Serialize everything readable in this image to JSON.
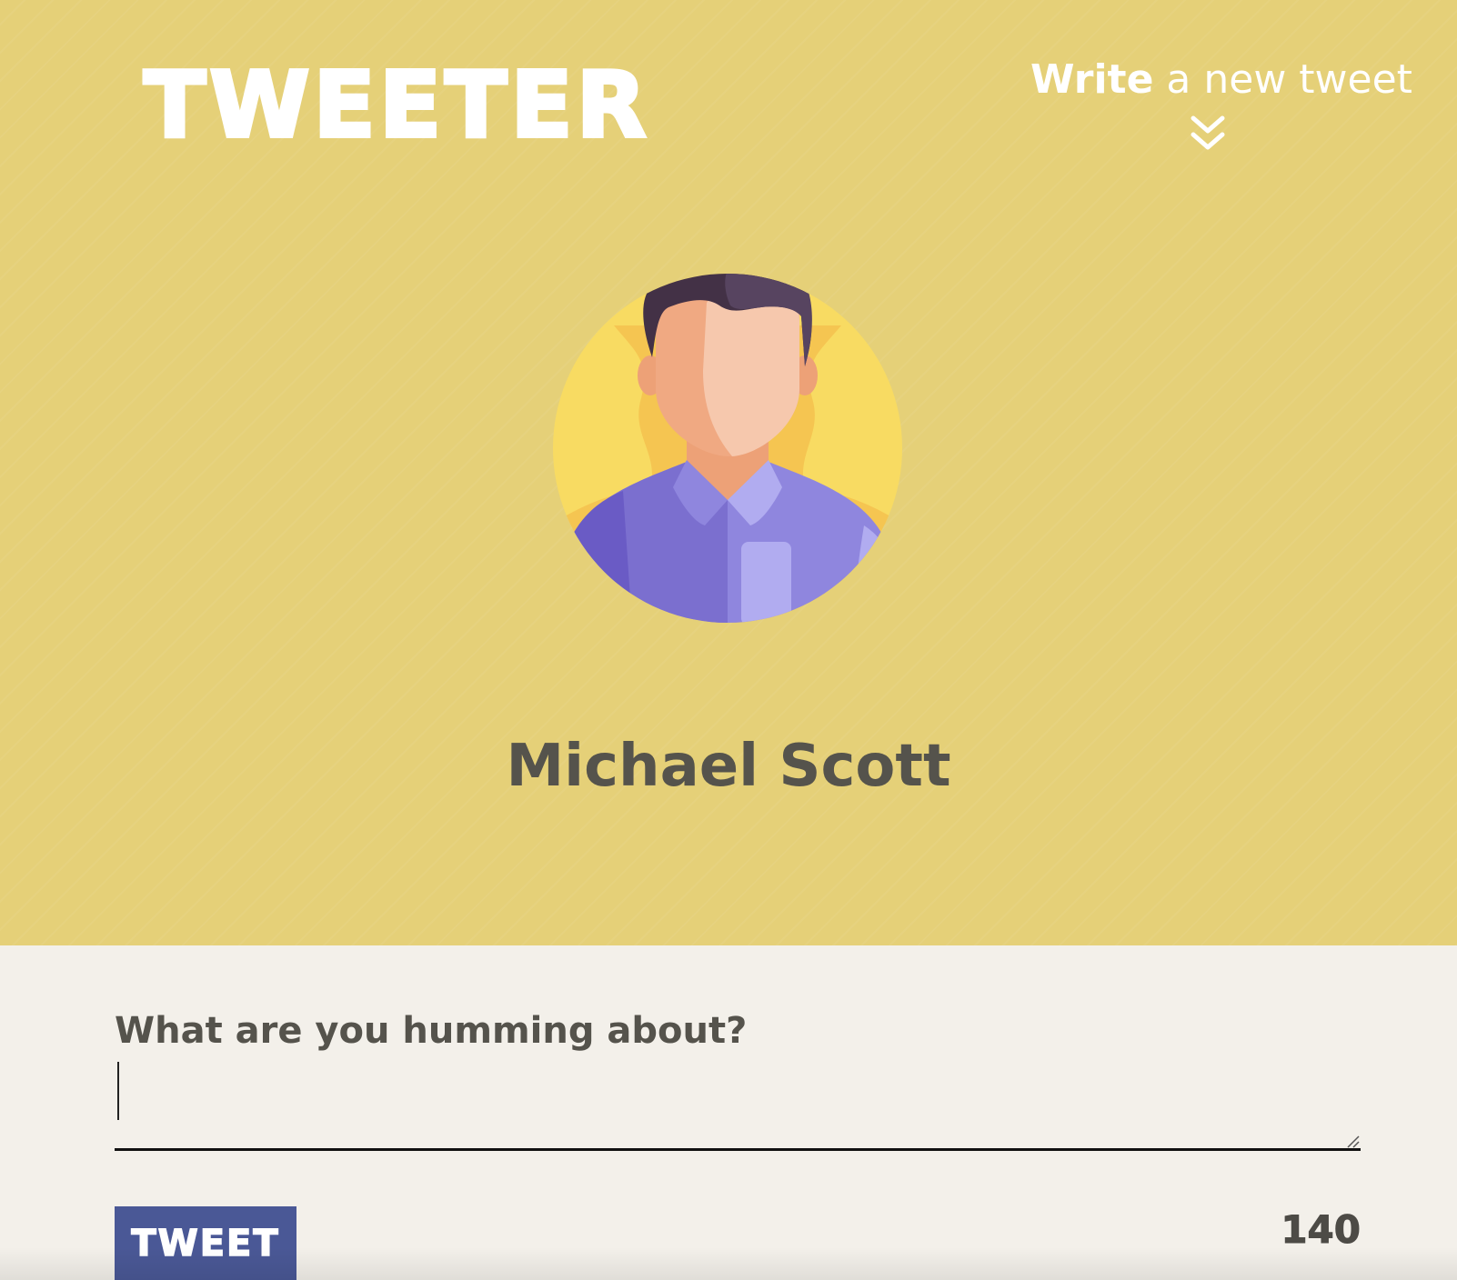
{
  "header": {
    "brand": "TWEETER",
    "compose_toggle": {
      "strong": "Write",
      "rest": " a new tweet",
      "icon": "double-chevron-down-icon"
    }
  },
  "profile": {
    "name": "Michael Scott",
    "avatar_icon": "avatar-icon"
  },
  "composer": {
    "label": "What are you humming about?",
    "value": "",
    "placeholder": "",
    "button_label": "TWEET",
    "char_count": "140"
  },
  "colors": {
    "hero_bg": "#e5d078",
    "page_bg": "#f3f0ea",
    "button_bg": "#4a5896",
    "text_dark": "#55534c"
  }
}
